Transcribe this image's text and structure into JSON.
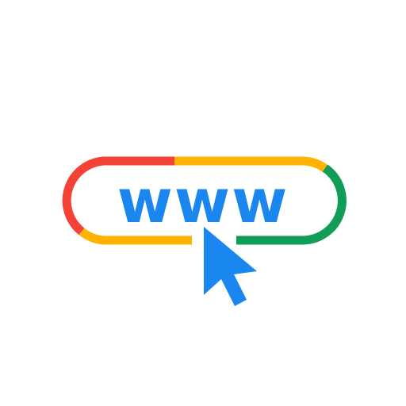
{
  "icon": {
    "name": "web-address-pointer",
    "text": "www",
    "colors": {
      "red": "#F44336",
      "yellow": "#FFB300",
      "green": "#0F9D58",
      "blue": "#1A86F0",
      "background": "#FFFFFF"
    }
  }
}
